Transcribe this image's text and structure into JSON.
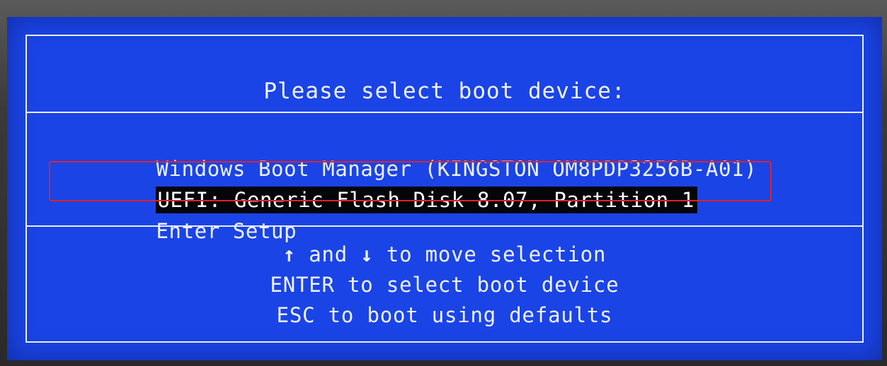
{
  "bios": {
    "title": "Please select boot device:",
    "boot_options": [
      {
        "label": "Windows Boot Manager (KINGSTON OM8PDP3256B-A01)",
        "selected": false
      },
      {
        "label": "UEFI: Generic Flash Disk 8.07, Partition 1",
        "selected": true
      },
      {
        "label": "Enter Setup",
        "selected": false
      }
    ],
    "help": {
      "up_arrow": "↑",
      "and_text": " and ",
      "down_arrow": "↓",
      "move_text": " to move selection",
      "enter_line": "ENTER to select boot device",
      "esc_line": "ESC to boot using defaults"
    }
  },
  "colors": {
    "background": "#1a44e6",
    "text": "#eef1ff",
    "selection_bg": "#05060a",
    "annotation": "#e0212a"
  }
}
